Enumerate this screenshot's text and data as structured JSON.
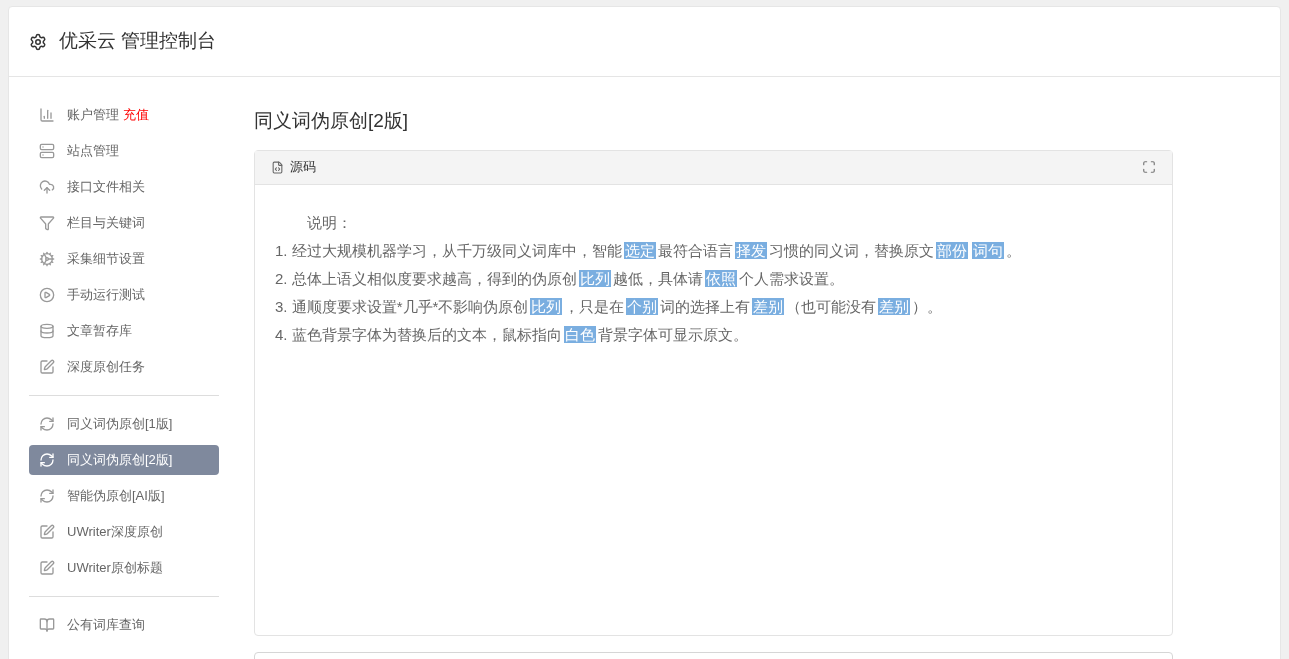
{
  "header": {
    "title": "优采云 管理控制台"
  },
  "sidebar": {
    "groups": [
      {
        "items": [
          {
            "label": "账户管理",
            "badge": "充值",
            "selected": false
          },
          {
            "label": "站点管理",
            "selected": false
          },
          {
            "label": "接口文件相关",
            "selected": false
          },
          {
            "label": "栏目与关键词",
            "selected": false
          },
          {
            "label": "采集细节设置",
            "selected": false
          },
          {
            "label": "手动运行测试",
            "selected": false
          },
          {
            "label": "文章暂存库",
            "selected": false
          },
          {
            "label": "深度原创任务",
            "selected": false
          }
        ]
      },
      {
        "items": [
          {
            "label": "同义词伪原创[1版]",
            "selected": false
          },
          {
            "label": "同义词伪原创[2版]",
            "selected": true
          },
          {
            "label": "智能伪原创[AI版]",
            "selected": false
          },
          {
            "label": "UWriter深度原创",
            "selected": false
          },
          {
            "label": "UWriter原创标题",
            "selected": false
          }
        ]
      },
      {
        "items": [
          {
            "label": "公有词库查询",
            "selected": false
          }
        ]
      }
    ]
  },
  "main": {
    "title": "同义词伪原创[2版]",
    "panel": {
      "tab": "源码",
      "heading": "说明：",
      "lines": [
        [
          {
            "text": "1. 经过大规模机器学习，从千万级同义词库中，智能",
            "highlighted": false
          },
          {
            "text": "选定",
            "highlighted": true
          },
          {
            "text": "最符合语言",
            "highlighted": false
          },
          {
            "text": "择发",
            "highlighted": true
          },
          {
            "text": "习惯的同义词，替换原文",
            "highlighted": false
          },
          {
            "text": "部份",
            "highlighted": true
          },
          {
            "text": "词句",
            "highlighted": true
          },
          {
            "text": "。",
            "highlighted": false
          }
        ],
        [
          {
            "text": "2. 总体上语义相似度要求越高，得到的伪原创",
            "highlighted": false
          },
          {
            "text": "比列",
            "highlighted": true
          },
          {
            "text": "越低，具体请",
            "highlighted": false
          },
          {
            "text": "依照",
            "highlighted": true
          },
          {
            "text": "个人需求设置。",
            "highlighted": false
          }
        ],
        [
          {
            "text": "3. 通顺度要求设置*几乎*不影响伪原创",
            "highlighted": false
          },
          {
            "text": "比列",
            "highlighted": true
          },
          {
            "text": "，只是在",
            "highlighted": false
          },
          {
            "text": "个别",
            "highlighted": true
          },
          {
            "text": "词的选择上有",
            "highlighted": false
          },
          {
            "text": "差别",
            "highlighted": true
          },
          {
            "text": "（也可能没有",
            "highlighted": false
          },
          {
            "text": "差别",
            "highlighted": true
          },
          {
            "text": "）。",
            "highlighted": false
          }
        ],
        [
          {
            "text": "4. 蓝色背景字体为替换后的文本，鼠标指向",
            "highlighted": false
          },
          {
            "text": "白色",
            "highlighted": true
          },
          {
            "text": "背景字体可显示原文。",
            "highlighted": false
          }
        ]
      ]
    }
  }
}
